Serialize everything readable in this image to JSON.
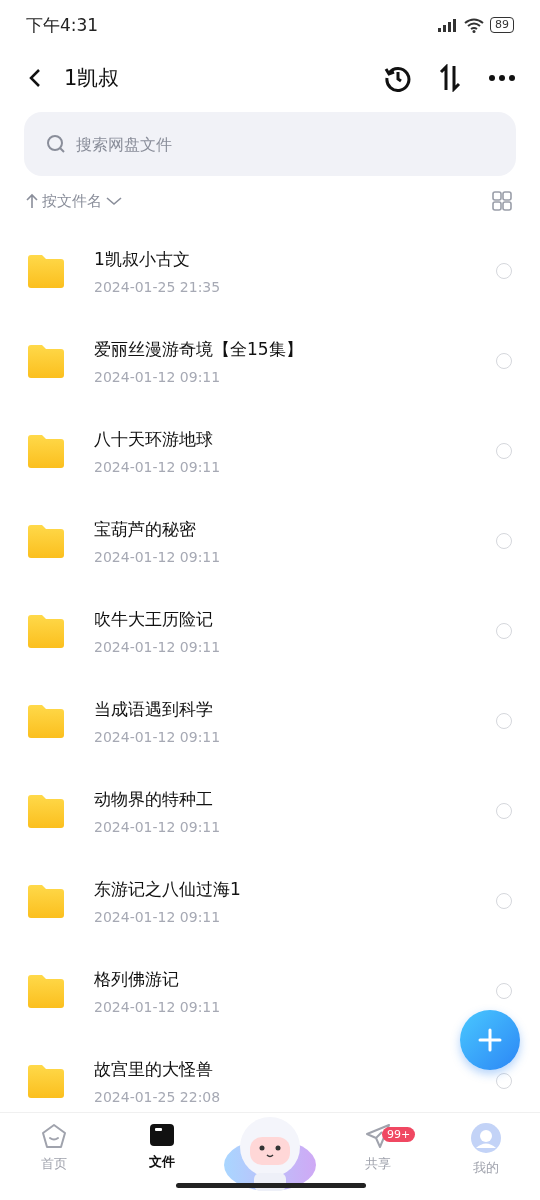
{
  "status_bar": {
    "time": "下午4:31",
    "battery": "89"
  },
  "header": {
    "title": "1凯叔"
  },
  "search": {
    "placeholder": "搜索网盘文件"
  },
  "sort": {
    "label": "按文件名"
  },
  "files": [
    {
      "name": "1凯叔小古文",
      "date": "2024-01-25  21:35",
      "selected": false
    },
    {
      "name": "爱丽丝漫游奇境【全15集】",
      "date": "2024-01-12  09:11",
      "selected": false
    },
    {
      "name": "八十天环游地球",
      "date": "2024-01-12  09:11",
      "selected": false
    },
    {
      "name": "宝葫芦的秘密",
      "date": "2024-01-12  09:11",
      "selected": false
    },
    {
      "name": "吹牛大王历险记",
      "date": "2024-01-12  09:11",
      "selected": false
    },
    {
      "name": "当成语遇到科学",
      "date": "2024-01-12  09:11",
      "selected": false
    },
    {
      "name": "动物界的特种工",
      "date": "2024-01-12  09:11",
      "selected": false
    },
    {
      "name": "东游记之八仙过海1",
      "date": "2024-01-12  09:11",
      "selected": false
    },
    {
      "name": "格列佛游记",
      "date": "2024-01-12  09:11",
      "selected": false
    },
    {
      "name": "故宫里的大怪兽",
      "date": "2024-01-25  22:08",
      "selected": false
    }
  ],
  "nav": [
    {
      "kind": "home",
      "label": "首页",
      "selected": false
    },
    {
      "kind": "files",
      "label": "文件",
      "selected": true
    },
    {
      "kind": "mascot"
    },
    {
      "kind": "share",
      "label": "共享",
      "selected": false,
      "badge": "99+"
    },
    {
      "kind": "me",
      "label": "我的",
      "selected": false
    }
  ]
}
